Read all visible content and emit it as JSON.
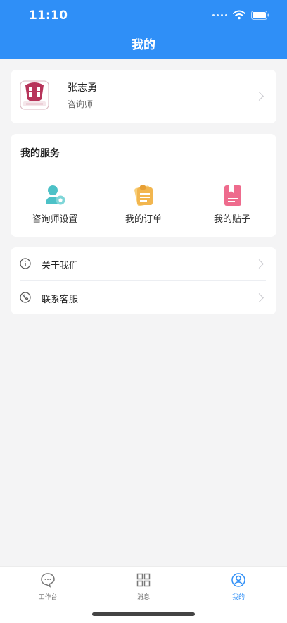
{
  "status_bar": {
    "time": "11:10"
  },
  "header": {
    "title": "我的"
  },
  "profile": {
    "name": "张志勇",
    "role": "咨询师"
  },
  "services": {
    "title": "我的服务",
    "items": [
      {
        "label": "咨询师设置",
        "icon": "counselor-settings-icon",
        "color": "#4cc1c7"
      },
      {
        "label": "我的订单",
        "icon": "order-icon",
        "color": "#f2b64f"
      },
      {
        "label": "我的贴子",
        "icon": "post-icon",
        "color": "#ee6b8d"
      }
    ]
  },
  "menu": {
    "items": [
      {
        "label": "关于我们",
        "icon": "info-icon"
      },
      {
        "label": "联系客服",
        "icon": "phone-icon"
      }
    ]
  },
  "tabbar": {
    "items": [
      {
        "label": "工作台",
        "icon": "chat-bubble-icon",
        "active": false
      },
      {
        "label": "消息",
        "icon": "grid-icon",
        "active": false
      },
      {
        "label": "我的",
        "icon": "user-icon",
        "active": true
      }
    ]
  },
  "colors": {
    "primary": "#2f8ff7",
    "background": "#f4f4f5"
  }
}
